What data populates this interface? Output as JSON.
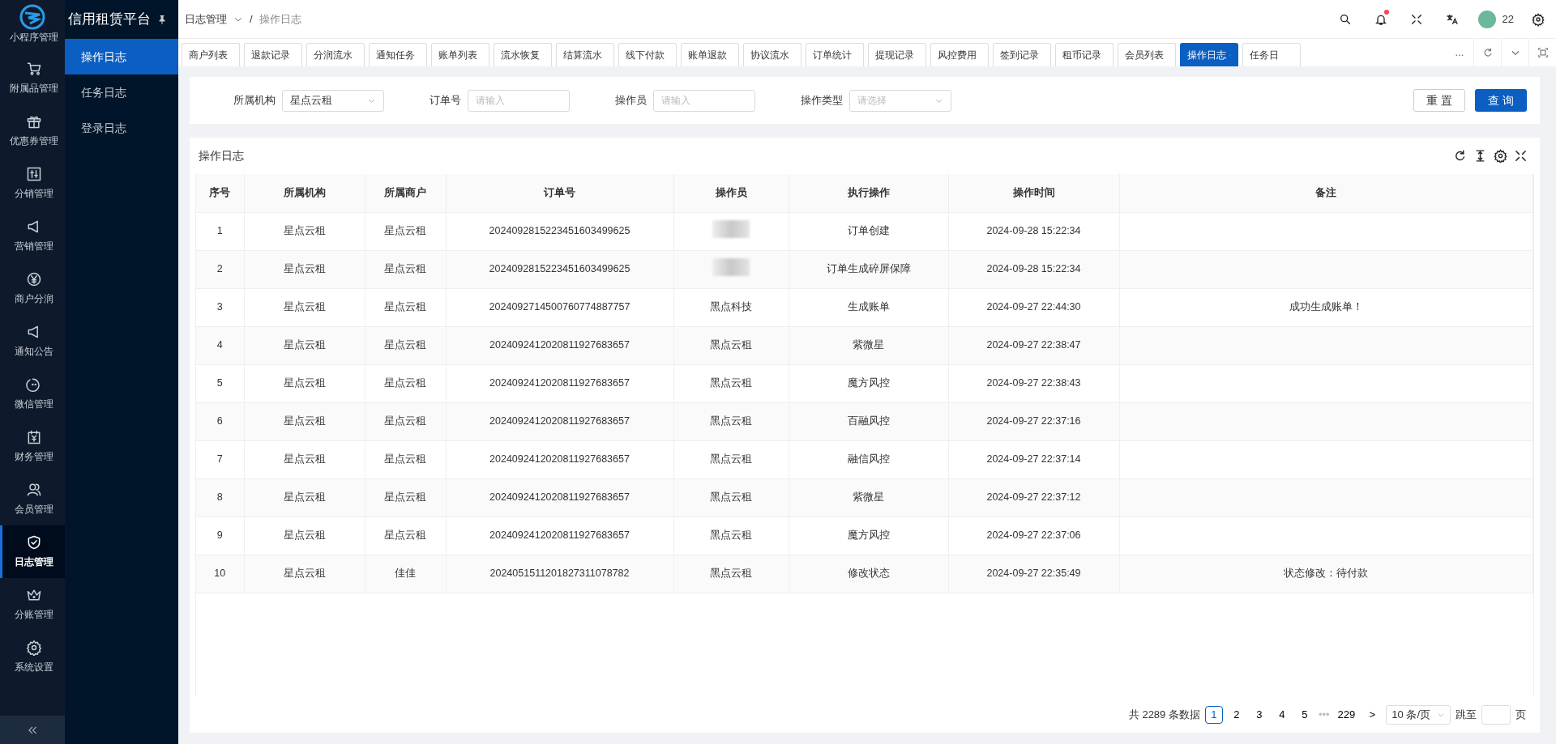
{
  "app": {
    "title": "信用租赁平台"
  },
  "sidebar": {
    "items": [
      {
        "label": "小程序管理",
        "selected": false
      },
      {
        "label": "附属品管理",
        "selected": false
      },
      {
        "label": "优惠券管理",
        "selected": false
      },
      {
        "label": "分销管理",
        "selected": false
      },
      {
        "label": "营销管理",
        "selected": false
      },
      {
        "label": "商户分润",
        "selected": false
      },
      {
        "label": "通知公告",
        "selected": false
      },
      {
        "label": "微信管理",
        "selected": false
      },
      {
        "label": "财务管理",
        "selected": false
      },
      {
        "label": "会员管理",
        "selected": false
      },
      {
        "label": "日志管理",
        "selected": true
      },
      {
        "label": "分账管理",
        "selected": false
      },
      {
        "label": "系统设置",
        "selected": false
      }
    ]
  },
  "submenu": {
    "items": [
      {
        "label": "操作日志",
        "selected": true
      },
      {
        "label": "任务日志",
        "selected": false
      },
      {
        "label": "登录日志",
        "selected": false
      }
    ]
  },
  "breadcrumb": [
    {
      "label": "日志管理"
    },
    {
      "label": "操作日志"
    }
  ],
  "breadcrumb_separator": "/",
  "header": {
    "notification_dot": true,
    "user": "22"
  },
  "tabs": [
    {
      "label": "商户列表",
      "selected": false
    },
    {
      "label": "退款记录",
      "selected": false
    },
    {
      "label": "分润流水",
      "selected": false
    },
    {
      "label": "通知任务",
      "selected": false
    },
    {
      "label": "账单列表",
      "selected": false
    },
    {
      "label": "流水恢复",
      "selected": false
    },
    {
      "label": "结算流水",
      "selected": false
    },
    {
      "label": "线下付款",
      "selected": false
    },
    {
      "label": "账单退款",
      "selected": false
    },
    {
      "label": "协议流水",
      "selected": false
    },
    {
      "label": "订单统计",
      "selected": false
    },
    {
      "label": "提现记录",
      "selected": false
    },
    {
      "label": "风控费用",
      "selected": false
    },
    {
      "label": "签到记录",
      "selected": false
    },
    {
      "label": "租币记录",
      "selected": false
    },
    {
      "label": "会员列表",
      "selected": false
    },
    {
      "label": "操作日志",
      "selected": true
    },
    {
      "label": "任务日",
      "selected": false
    }
  ],
  "tabs_more": "...",
  "filters": [
    {
      "kind": "select",
      "label": "所属机构",
      "value": "星点云租"
    },
    {
      "kind": "input",
      "label": "订单号",
      "placeholder": "请输入"
    },
    {
      "kind": "input",
      "label": "操作员",
      "placeholder": "请输入"
    },
    {
      "kind": "select",
      "label": "操作类型",
      "placeholder": "请选择"
    }
  ],
  "buttons": {
    "reset": "重 置",
    "search": "查 询"
  },
  "table": {
    "title": "操作日志",
    "columns": [
      "序号",
      "所属机构",
      "所属商户",
      "订单号",
      "操作员",
      "执行操作",
      "操作时间",
      "备注"
    ],
    "rows": [
      {
        "cells": [
          "1",
          "星点云租",
          "星点云租",
          "2024092815223451603499625",
          "",
          "订单创建",
          "2024-09-28 15:22:34",
          ""
        ],
        "operator_redacted": true
      },
      {
        "cells": [
          "2",
          "星点云租",
          "星点云租",
          "2024092815223451603499625",
          "",
          "订单生成碎屏保障",
          "2024-09-28 15:22:34",
          ""
        ],
        "operator_redacted": true
      },
      {
        "cells": [
          "3",
          "星点云租",
          "星点云租",
          "2024092714500760774887757",
          "黑点科技",
          "生成账单",
          "2024-09-27 22:44:30",
          "成功生成账单！"
        ],
        "operator_redacted": false
      },
      {
        "cells": [
          "4",
          "星点云租",
          "星点云租",
          "2024092412020811927683657",
          "黑点云租",
          "紫微星",
          "2024-09-27 22:38:47",
          ""
        ],
        "operator_redacted": false
      },
      {
        "cells": [
          "5",
          "星点云租",
          "星点云租",
          "2024092412020811927683657",
          "黑点云租",
          "魔方风控",
          "2024-09-27 22:38:43",
          ""
        ],
        "operator_redacted": false
      },
      {
        "cells": [
          "6",
          "星点云租",
          "星点云租",
          "2024092412020811927683657",
          "黑点云租",
          "百融风控",
          "2024-09-27 22:37:16",
          ""
        ],
        "operator_redacted": false
      },
      {
        "cells": [
          "7",
          "星点云租",
          "星点云租",
          "2024092412020811927683657",
          "黑点云租",
          "融信风控",
          "2024-09-27 22:37:14",
          ""
        ],
        "operator_redacted": false
      },
      {
        "cells": [
          "8",
          "星点云租",
          "星点云租",
          "2024092412020811927683657",
          "黑点云租",
          "紫微星",
          "2024-09-27 22:37:12",
          ""
        ],
        "operator_redacted": false
      },
      {
        "cells": [
          "9",
          "星点云租",
          "星点云租",
          "2024092412020811927683657",
          "黑点云租",
          "魔方风控",
          "2024-09-27 22:37:06",
          ""
        ],
        "operator_redacted": false
      },
      {
        "cells": [
          "10",
          "星点云租",
          "佳佳",
          "2024051511201827311078782",
          "黑点云租",
          "修改状态",
          "2024-09-27 22:35:49",
          "状态修改：待付款"
        ],
        "operator_redacted": false
      }
    ]
  },
  "pagination": {
    "total": "共 2289 条数据",
    "pages": [
      {
        "label": "1",
        "selected": true
      },
      {
        "label": "2",
        "selected": false
      },
      {
        "label": "3",
        "selected": false
      },
      {
        "label": "4",
        "selected": false
      },
      {
        "label": "5",
        "selected": false
      }
    ],
    "ellipsis": "•••",
    "last": "229",
    "next": ">",
    "page_size": "10 条/页",
    "jump_label": "跳至",
    "jump_suffix": "页"
  }
}
